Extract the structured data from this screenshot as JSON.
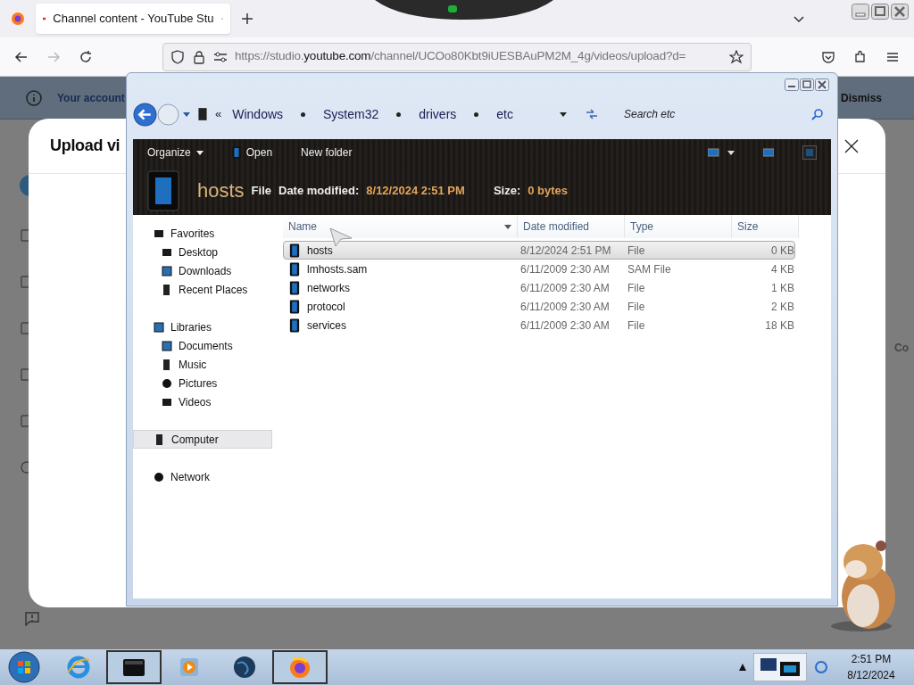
{
  "browser": {
    "tab": {
      "title": "Channel content - YouTube Stu"
    },
    "url": {
      "prefix": "https://studio.",
      "domain": "youtube.com",
      "path": "/channel/UCOo80Kbt9iUESBAuPM2M_4g/videos/upload?d="
    },
    "banner": {
      "text": "Your account",
      "action": "Dismiss"
    },
    "dialog": {
      "title": "Upload vi"
    },
    "side_text": "Co"
  },
  "explorer": {
    "overflow": "«",
    "breadcrumb": [
      "Windows",
      "System32",
      "drivers",
      "etc"
    ],
    "search": {
      "placeholder": "Search etc"
    },
    "toolbar": [
      {
        "kind": "menu",
        "label": "Organize"
      },
      {
        "kind": "open",
        "label": "Open"
      },
      {
        "kind": "plain",
        "label": "New folder"
      }
    ],
    "details": {
      "name": "hosts",
      "type": "File",
      "fields": [
        {
          "label": "Date modified:",
          "value": "8/12/2024 2:51 PM"
        },
        {
          "label": "Size:",
          "value": "0 bytes"
        }
      ]
    },
    "nav": [
      {
        "label": "Favorites",
        "selected": false,
        "children": [
          {
            "label": "Desktop",
            "selected": false
          },
          {
            "label": "Downloads",
            "selected": false
          },
          {
            "label": "Recent Places",
            "selected": false
          }
        ]
      },
      {
        "label": "Libraries",
        "selected": false,
        "children": [
          {
            "label": "Documents",
            "selected": false
          },
          {
            "label": "Music",
            "selected": false
          },
          {
            "label": "Pictures",
            "selected": false
          },
          {
            "label": "Videos",
            "selected": false
          }
        ]
      },
      {
        "label": "Computer",
        "selected": true
      },
      {
        "label": "Network",
        "selected": false
      }
    ],
    "columns": [
      "Name",
      "Date modified",
      "Type",
      "Size"
    ],
    "rows": [
      {
        "name": "hosts",
        "date": "8/12/2024 2:51 PM",
        "type": "File",
        "size": "0 KB",
        "selected": true
      },
      {
        "name": "lmhosts.sam",
        "date": "6/11/2009 2:30 AM",
        "type": "SAM File",
        "size": "4 KB",
        "selected": false
      },
      {
        "name": "networks",
        "date": "6/11/2009 2:30 AM",
        "type": "File",
        "size": "1 KB",
        "selected": false
      },
      {
        "name": "protocol",
        "date": "6/11/2009 2:30 AM",
        "type": "File",
        "size": "2 KB",
        "selected": false
      },
      {
        "name": "services",
        "date": "6/11/2009 2:30 AM",
        "type": "File",
        "size": "18 KB",
        "selected": false
      }
    ]
  },
  "taskbar": {
    "apps": [
      {
        "kind": "ie",
        "open": false
      },
      {
        "kind": "explorer",
        "open": true
      },
      {
        "kind": "media",
        "open": false
      },
      {
        "kind": "globe",
        "open": false
      },
      {
        "kind": "firefox",
        "open": true
      }
    ],
    "time": "2:51 PM",
    "date": "8/12/2024"
  }
}
